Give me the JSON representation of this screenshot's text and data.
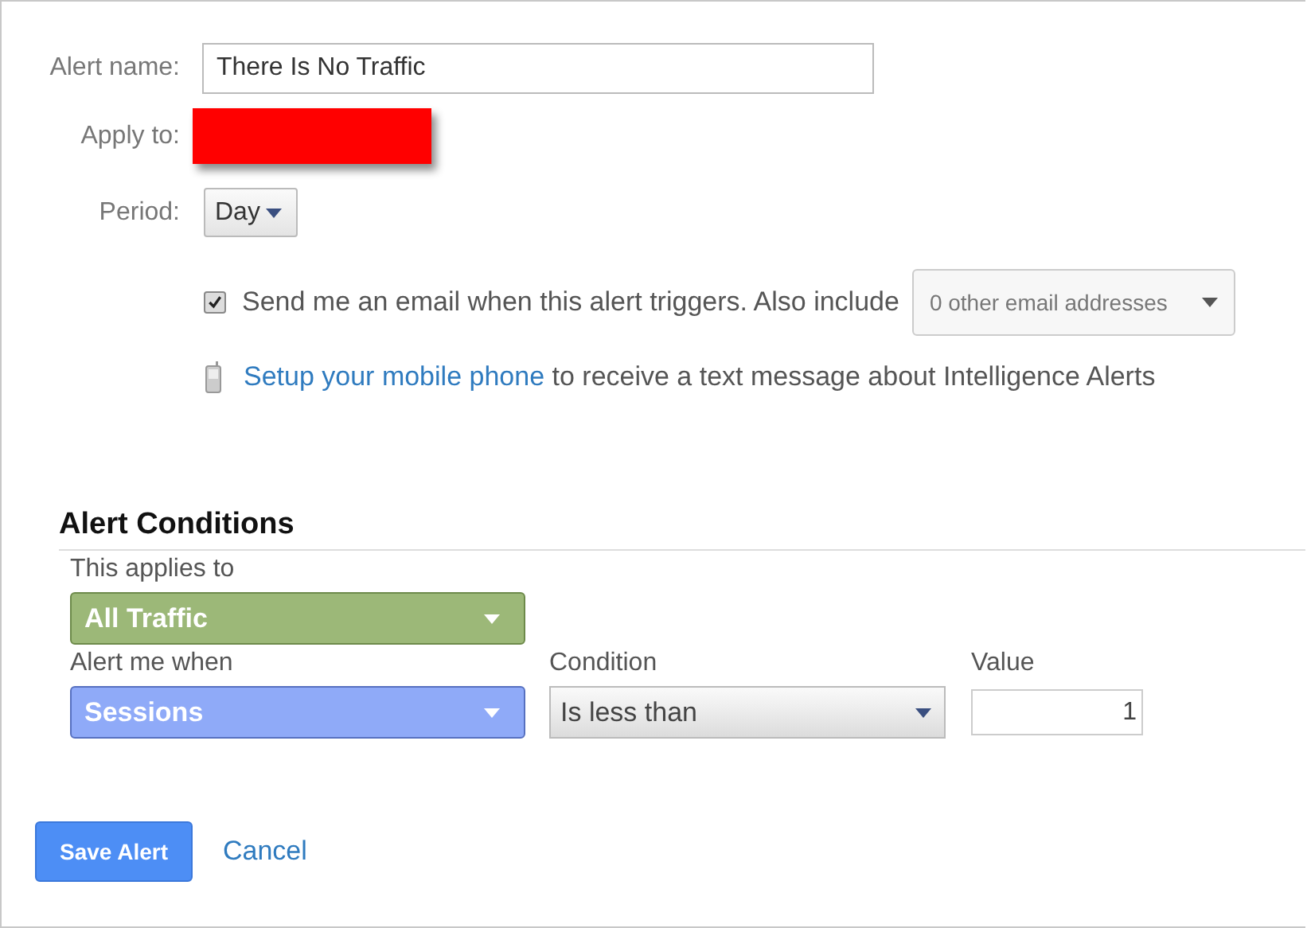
{
  "form": {
    "alert_name_label": "Alert name:",
    "alert_name_value": "There Is No Traffic",
    "apply_to_label": "Apply to:",
    "period_label": "Period:",
    "period_value": "Day"
  },
  "email": {
    "checked": true,
    "text": "Send me an email when this alert triggers. Also include",
    "addresses": "0 other email addresses"
  },
  "mobile": {
    "link": "Setup your mobile phone",
    "text": "to receive a text message about Intelligence Alerts"
  },
  "conditions": {
    "heading": "Alert Conditions",
    "applies_label": "This applies to",
    "applies_value": "All Traffic",
    "alert_label": "Alert me when",
    "alert_value": "Sessions",
    "condition_label": "Condition",
    "condition_value": "Is less than",
    "value_label": "Value",
    "value": "1"
  },
  "buttons": {
    "save": "Save Alert",
    "cancel": "Cancel"
  }
}
